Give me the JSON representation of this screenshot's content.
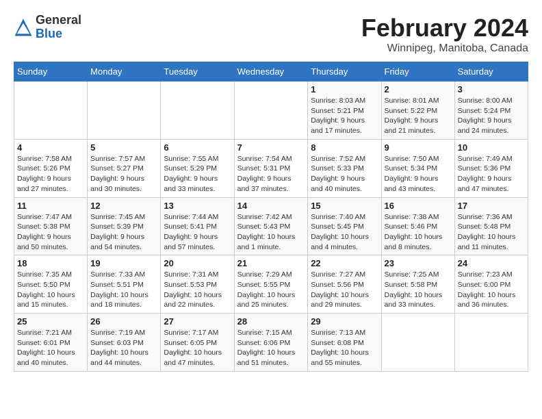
{
  "logo": {
    "general": "General",
    "blue": "Blue"
  },
  "header": {
    "month": "February 2024",
    "location": "Winnipeg, Manitoba, Canada"
  },
  "weekdays": [
    "Sunday",
    "Monday",
    "Tuesday",
    "Wednesday",
    "Thursday",
    "Friday",
    "Saturday"
  ],
  "weeks": [
    [
      {
        "day": "",
        "info": ""
      },
      {
        "day": "",
        "info": ""
      },
      {
        "day": "",
        "info": ""
      },
      {
        "day": "",
        "info": ""
      },
      {
        "day": "1",
        "info": "Sunrise: 8:03 AM\nSunset: 5:21 PM\nDaylight: 9 hours\nand 17 minutes."
      },
      {
        "day": "2",
        "info": "Sunrise: 8:01 AM\nSunset: 5:22 PM\nDaylight: 9 hours\nand 21 minutes."
      },
      {
        "day": "3",
        "info": "Sunrise: 8:00 AM\nSunset: 5:24 PM\nDaylight: 9 hours\nand 24 minutes."
      }
    ],
    [
      {
        "day": "4",
        "info": "Sunrise: 7:58 AM\nSunset: 5:26 PM\nDaylight: 9 hours\nand 27 minutes."
      },
      {
        "day": "5",
        "info": "Sunrise: 7:57 AM\nSunset: 5:27 PM\nDaylight: 9 hours\nand 30 minutes."
      },
      {
        "day": "6",
        "info": "Sunrise: 7:55 AM\nSunset: 5:29 PM\nDaylight: 9 hours\nand 33 minutes."
      },
      {
        "day": "7",
        "info": "Sunrise: 7:54 AM\nSunset: 5:31 PM\nDaylight: 9 hours\nand 37 minutes."
      },
      {
        "day": "8",
        "info": "Sunrise: 7:52 AM\nSunset: 5:33 PM\nDaylight: 9 hours\nand 40 minutes."
      },
      {
        "day": "9",
        "info": "Sunrise: 7:50 AM\nSunset: 5:34 PM\nDaylight: 9 hours\nand 43 minutes."
      },
      {
        "day": "10",
        "info": "Sunrise: 7:49 AM\nSunset: 5:36 PM\nDaylight: 9 hours\nand 47 minutes."
      }
    ],
    [
      {
        "day": "11",
        "info": "Sunrise: 7:47 AM\nSunset: 5:38 PM\nDaylight: 9 hours\nand 50 minutes."
      },
      {
        "day": "12",
        "info": "Sunrise: 7:45 AM\nSunset: 5:39 PM\nDaylight: 9 hours\nand 54 minutes."
      },
      {
        "day": "13",
        "info": "Sunrise: 7:44 AM\nSunset: 5:41 PM\nDaylight: 9 hours\nand 57 minutes."
      },
      {
        "day": "14",
        "info": "Sunrise: 7:42 AM\nSunset: 5:43 PM\nDaylight: 10 hours\nand 1 minute."
      },
      {
        "day": "15",
        "info": "Sunrise: 7:40 AM\nSunset: 5:45 PM\nDaylight: 10 hours\nand 4 minutes."
      },
      {
        "day": "16",
        "info": "Sunrise: 7:38 AM\nSunset: 5:46 PM\nDaylight: 10 hours\nand 8 minutes."
      },
      {
        "day": "17",
        "info": "Sunrise: 7:36 AM\nSunset: 5:48 PM\nDaylight: 10 hours\nand 11 minutes."
      }
    ],
    [
      {
        "day": "18",
        "info": "Sunrise: 7:35 AM\nSunset: 5:50 PM\nDaylight: 10 hours\nand 15 minutes."
      },
      {
        "day": "19",
        "info": "Sunrise: 7:33 AM\nSunset: 5:51 PM\nDaylight: 10 hours\nand 18 minutes."
      },
      {
        "day": "20",
        "info": "Sunrise: 7:31 AM\nSunset: 5:53 PM\nDaylight: 10 hours\nand 22 minutes."
      },
      {
        "day": "21",
        "info": "Sunrise: 7:29 AM\nSunset: 5:55 PM\nDaylight: 10 hours\nand 25 minutes."
      },
      {
        "day": "22",
        "info": "Sunrise: 7:27 AM\nSunset: 5:56 PM\nDaylight: 10 hours\nand 29 minutes."
      },
      {
        "day": "23",
        "info": "Sunrise: 7:25 AM\nSunset: 5:58 PM\nDaylight: 10 hours\nand 33 minutes."
      },
      {
        "day": "24",
        "info": "Sunrise: 7:23 AM\nSunset: 6:00 PM\nDaylight: 10 hours\nand 36 minutes."
      }
    ],
    [
      {
        "day": "25",
        "info": "Sunrise: 7:21 AM\nSunset: 6:01 PM\nDaylight: 10 hours\nand 40 minutes."
      },
      {
        "day": "26",
        "info": "Sunrise: 7:19 AM\nSunset: 6:03 PM\nDaylight: 10 hours\nand 44 minutes."
      },
      {
        "day": "27",
        "info": "Sunrise: 7:17 AM\nSunset: 6:05 PM\nDaylight: 10 hours\nand 47 minutes."
      },
      {
        "day": "28",
        "info": "Sunrise: 7:15 AM\nSunset: 6:06 PM\nDaylight: 10 hours\nand 51 minutes."
      },
      {
        "day": "29",
        "info": "Sunrise: 7:13 AM\nSunset: 6:08 PM\nDaylight: 10 hours\nand 55 minutes."
      },
      {
        "day": "",
        "info": ""
      },
      {
        "day": "",
        "info": ""
      }
    ]
  ]
}
